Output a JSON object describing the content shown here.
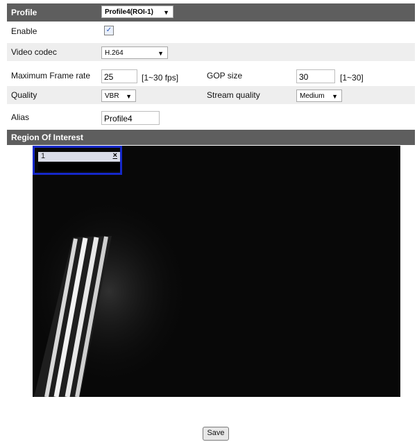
{
  "profile": {
    "label": "Profile",
    "value": "Profile4(ROI-1)"
  },
  "enable": {
    "label": "Enable",
    "checked": true
  },
  "video_codec": {
    "label": "Video codec",
    "value": "H.264"
  },
  "max_frame_rate": {
    "label": "Maximum Frame rate",
    "value": "25",
    "range": "[1~30 fps]"
  },
  "gop_size": {
    "label": "GOP size",
    "value": "30",
    "range": "[1~30]"
  },
  "quality": {
    "label": "Quality",
    "value": "VBR"
  },
  "stream_quality": {
    "label": "Stream quality",
    "value": "Medium"
  },
  "alias": {
    "label": "Alias",
    "value": "Profile4"
  },
  "roi": {
    "title": "Region Of Interest",
    "window_number": "1",
    "close_symbol": "×"
  },
  "save_label": "Save"
}
